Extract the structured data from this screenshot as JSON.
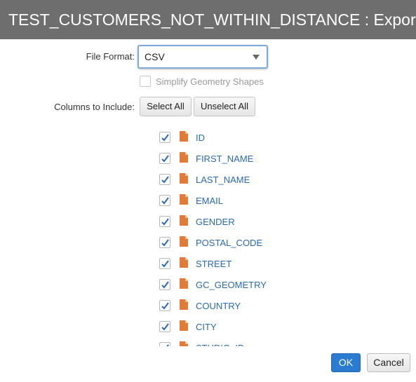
{
  "dialog": {
    "title": "TEST_CUSTOMERS_NOT_WITHIN_DISTANCE : Export"
  },
  "file_format": {
    "label": "File Format:",
    "value": "CSV",
    "icon": "chevron-down-icon"
  },
  "simplify": {
    "label": "Simplify Geometry Shapes",
    "checked": false,
    "disabled": true
  },
  "columns": {
    "label": "Columns to Include:",
    "select_all": "Select All",
    "unselect_all": "Unselect All",
    "items": [
      {
        "name": "ID",
        "checked": true
      },
      {
        "name": "FIRST_NAME",
        "checked": true
      },
      {
        "name": "LAST_NAME",
        "checked": true
      },
      {
        "name": "EMAIL",
        "checked": true
      },
      {
        "name": "GENDER",
        "checked": true
      },
      {
        "name": "POSTAL_CODE",
        "checked": true
      },
      {
        "name": "STREET",
        "checked": true
      },
      {
        "name": "GC_GEOMETRY",
        "checked": true
      },
      {
        "name": "COUNTRY",
        "checked": true
      },
      {
        "name": "CITY",
        "checked": true
      },
      {
        "name": "STUDIO_ID",
        "checked": true
      }
    ]
  },
  "footer": {
    "ok": "OK",
    "cancel": "Cancel"
  },
  "colors": {
    "titlebar": "#6e6e6e",
    "primary_button": "#2b7bd1",
    "column_text": "#2a6ab0",
    "file_icon": "#e07b39",
    "checkmark": "#2a6ab0"
  }
}
